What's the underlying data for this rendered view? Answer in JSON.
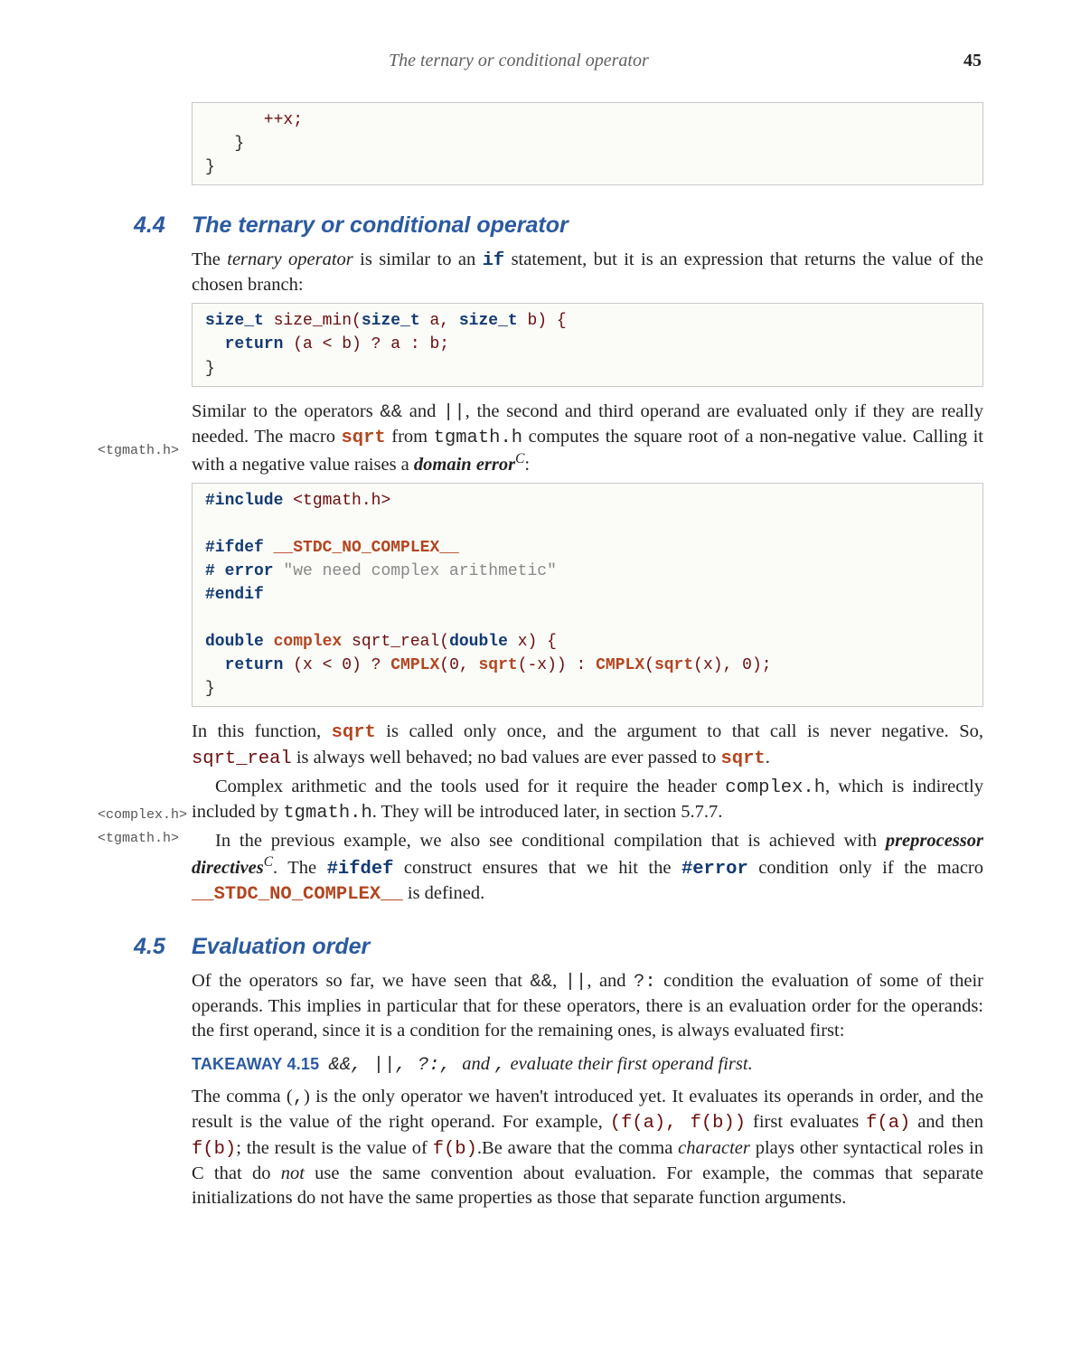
{
  "header": {
    "running_title": "The ternary or conditional operator",
    "page_number": "45"
  },
  "margin_notes": {
    "m1": "<tgmath.h>",
    "m2": "<complex.h>",
    "m3": "<tgmath.h>"
  },
  "code0": {
    "l1": "      ++x;",
    "l2": "   }",
    "l3": "}"
  },
  "sec44": {
    "num": "4.4",
    "title": "The ternary or conditional operator"
  },
  "p1a": "The ",
  "p1b": "ternary operator",
  "p1c": " is similar to an ",
  "p1d": "if",
  "p1e": " statement, but it is an expression that returns the value of the chosen branch:",
  "code1": {
    "l1a": "size_t",
    "l1b": " size_min(",
    "l1c": "size_t",
    "l1d": " a, ",
    "l1e": "size_t",
    "l1f": " b) {",
    "l2a": "  ",
    "l2b": "return",
    "l2c": " (a < b) ? a : b;",
    "l3": "}"
  },
  "p2": {
    "a": "Similar to the operators ",
    "op1": "&&",
    "b": " and ",
    "op2": "||",
    "c": ", the second and third operand are evaluated only if they are really needed. The macro ",
    "sqrt": "sqrt",
    "d": " from ",
    "tg": "tgmath.h",
    "e": " computes the square root of a non-negative value. Calling it with a negative value raises a ",
    "term": "domain error",
    "sup": "C",
    "f": ":"
  },
  "code2": {
    "l1a": "#include",
    "l1b": " <tgmath.h>",
    "blank1": "",
    "l2a": "#ifdef",
    "l2b": " __STDC_NO_COMPLEX__",
    "l3a": "# error",
    "l3b": " \"we need complex arithmetic\"",
    "l4": "#endif",
    "blank2": "",
    "l5a": "double",
    "l5b": " ",
    "l5c": "complex",
    "l5d": " sqrt_real(",
    "l5e": "double",
    "l5f": " x) {",
    "l6a": "  ",
    "l6b": "return",
    "l6c": " (x < 0) ? ",
    "l6d": "CMPLX",
    "l6e": "(0, ",
    "l6f": "sqrt",
    "l6g": "(-x)) : ",
    "l6h": "CMPLX",
    "l6i": "(",
    "l6j": "sqrt",
    "l6k": "(x), 0);",
    "l7": "}"
  },
  "p3": {
    "a": "In this function, ",
    "sqrt1": "sqrt",
    "b": " is called only once, and the argument to that call is never negative. So, ",
    "sr": "sqrt_real",
    "c": " is always well behaved; no bad values are ever passed to ",
    "sqrt2": "sqrt",
    "d": "."
  },
  "p4": {
    "a": "Complex arithmetic and the tools used for it require the header ",
    "ch": "complex.h",
    "b": ", which is indirectly included by ",
    "tg": "tgmath.h",
    "c": ". They will be introduced later, in section 5.7.7."
  },
  "p5": {
    "a": "In the previous example, we also see conditional compilation that is achieved with ",
    "term": "preprocessor directives",
    "sup": "C",
    "b": ". The ",
    "ifdef": "#ifdef",
    "c": " construct ensures that we hit the ",
    "error": "#error",
    "d": " condition only if the macro ",
    "macro": "__STDC_NO_COMPLEX__",
    "e": " is defined."
  },
  "sec45": {
    "num": "4.5",
    "title": "Evaluation order"
  },
  "p6": {
    "a": "Of the operators so far, we have seen that ",
    "op1": "&&",
    "b": ", ",
    "op2": "||",
    "c": ", and ",
    "op3": "?:",
    "d": " condition the evaluation of some of their operands. This implies in particular that for these operators, there is an evaluation order for the operands: the first operand, since it is a condition for the remaining ones, is always evaluated first:"
  },
  "takeaway": {
    "label": "TAKEAWAY 4.15",
    "ops": "&&, ||, ?:, ",
    "and": "and ",
    "comma": ",",
    "text": " evaluate their first operand first."
  },
  "p7": {
    "a": "The comma (",
    "comma": ",",
    "b": ") is the only operator we haven't introduced yet. It evaluates its operands in order, and the result is the value of the right operand. For example, ",
    "ex1": "(f(a), f(b))",
    "c": " first evaluates ",
    "fa": "f(a)",
    "d": " and then ",
    "fb1": "f(b)",
    "e": "; the result is the value of ",
    "fb2": "f(b)",
    "f": ".Be aware that the comma ",
    "char": "character",
    "g": " plays other syntactical roles in C that do ",
    "not": "not",
    "h": " use the same convention about evaluation. For example, the commas that separate initializations do not have the same properties as those that separate function arguments."
  }
}
